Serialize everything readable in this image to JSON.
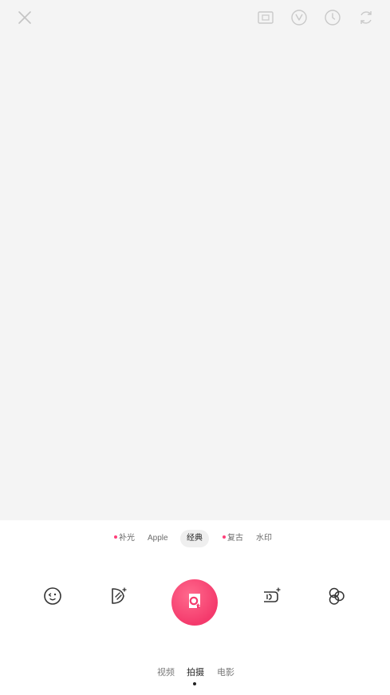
{
  "top_bar": {
    "close_icon": "close-icon",
    "icons": [
      "frame-ratio-icon",
      "beauty-icon",
      "timer-icon",
      "flip-camera-icon"
    ]
  },
  "filters": [
    {
      "label": "补光",
      "has_dot": true
    },
    {
      "label": "Apple",
      "has_dot": false
    },
    {
      "label": "经典",
      "has_dot": false,
      "selected": true
    },
    {
      "label": "复古",
      "has_dot": true
    },
    {
      "label": "水印",
      "has_dot": false
    }
  ],
  "tools": {
    "left": [
      "sticker-face-icon",
      "magic-sticker-icon"
    ],
    "right": [
      "ai-camera-icon",
      "filter-circles-icon"
    ]
  },
  "shutter": {
    "icon": "camera-cup-icon"
  },
  "modes": [
    {
      "label": "视频"
    },
    {
      "label": "拍摄",
      "active": true
    },
    {
      "label": "电影"
    }
  ],
  "colors": {
    "accent": "#f43a6c",
    "dot": "#ff3f7a",
    "viewfinder_bg": "#f4f4f4",
    "icon_gray": "#c9c9c9",
    "icon_dark": "#333333"
  }
}
